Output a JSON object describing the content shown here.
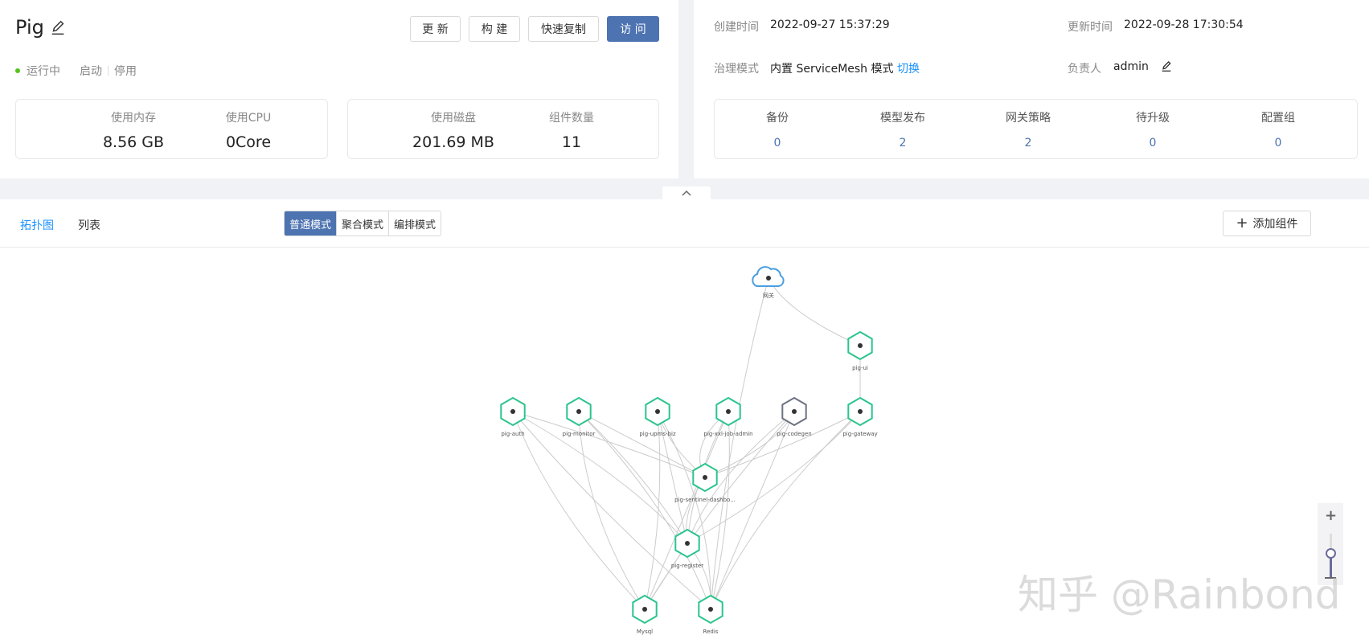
{
  "app": {
    "name": "Pig",
    "status": "运行中",
    "actions": [
      "启动",
      "停用"
    ]
  },
  "toolbar": {
    "update_label": "更 新",
    "build_label": "构 建",
    "copy_label": "快速复制",
    "visit_label": "访 问"
  },
  "stats": {
    "memory_label": "使用内存",
    "memory_value": "8.56 GB",
    "cpu_label": "使用CPU",
    "cpu_value": "0Core",
    "disk_label": "使用磁盘",
    "disk_value": "201.69 MB",
    "components_label": "组件数量",
    "components_value": "11"
  },
  "info": {
    "created_label": "创建时间",
    "created_value": "2022-09-27 15:37:29",
    "updated_label": "更新时间",
    "updated_value": "2022-09-28 17:30:54",
    "governance_label": "治理模式",
    "governance_value": "内置 ServiceMesh 模式",
    "governance_switch": "切换",
    "owner_label": "负责人",
    "owner_value": "admin"
  },
  "counts": [
    {
      "label": "备份",
      "value": "0"
    },
    {
      "label": "模型发布",
      "value": "2"
    },
    {
      "label": "网关策略",
      "value": "2"
    },
    {
      "label": "待升级",
      "value": "0"
    },
    {
      "label": "配置组",
      "value": "0"
    }
  ],
  "view": {
    "tabs": [
      "拓扑图",
      "列表"
    ],
    "active_tab": "拓扑图",
    "modes": [
      "普通模式",
      "聚合模式",
      "编排模式"
    ],
    "active_mode": "普通模式",
    "add_component_label": "添加组件"
  },
  "topology": {
    "nodes": [
      {
        "id": "gateway-cloud",
        "label": "网关",
        "kind": "cloud"
      },
      {
        "id": "pig-ui",
        "label": "pig-ui",
        "kind": "running"
      },
      {
        "id": "pig-auth",
        "label": "pig-auth",
        "kind": "running"
      },
      {
        "id": "pig-monitor",
        "label": "pig-monitor",
        "kind": "running"
      },
      {
        "id": "pig-upms-biz",
        "label": "pig-upms-biz",
        "kind": "running"
      },
      {
        "id": "pig-xxl-job-admin",
        "label": "pig-xxl-job-admin",
        "kind": "running"
      },
      {
        "id": "pig-codegen",
        "label": "pig-codegen",
        "kind": "stopped"
      },
      {
        "id": "pig-gateway",
        "label": "pig-gateway",
        "kind": "running"
      },
      {
        "id": "pig-sentinel",
        "label": "pig-sentinel-dashbo...",
        "kind": "running"
      },
      {
        "id": "pig-register",
        "label": "pig-register",
        "kind": "running"
      },
      {
        "id": "mysql",
        "label": "Mysql",
        "kind": "running"
      },
      {
        "id": "redis",
        "label": "Redis",
        "kind": "running"
      }
    ],
    "edges": [
      [
        "gateway-cloud",
        "pig-ui"
      ],
      [
        "gateway-cloud",
        "redis"
      ],
      [
        "pig-ui",
        "pig-gateway"
      ],
      [
        "pig-auth",
        "pig-sentinel"
      ],
      [
        "pig-auth",
        "pig-register"
      ],
      [
        "pig-auth",
        "mysql"
      ],
      [
        "pig-auth",
        "redis"
      ],
      [
        "pig-monitor",
        "pig-sentinel"
      ],
      [
        "pig-monitor",
        "pig-register"
      ],
      [
        "pig-monitor",
        "redis"
      ],
      [
        "pig-monitor",
        "mysql"
      ],
      [
        "pig-upms-biz",
        "pig-sentinel"
      ],
      [
        "pig-upms-biz",
        "pig-register"
      ],
      [
        "pig-upms-biz",
        "mysql"
      ],
      [
        "pig-upms-biz",
        "redis"
      ],
      [
        "pig-xxl-job-admin",
        "pig-sentinel"
      ],
      [
        "pig-xxl-job-admin",
        "pig-register"
      ],
      [
        "pig-xxl-job-admin",
        "mysql"
      ],
      [
        "pig-xxl-job-admin",
        "redis"
      ],
      [
        "pig-codegen",
        "pig-sentinel"
      ],
      [
        "pig-codegen",
        "pig-register"
      ],
      [
        "pig-codegen",
        "mysql"
      ],
      [
        "pig-codegen",
        "redis"
      ],
      [
        "pig-gateway",
        "pig-sentinel"
      ],
      [
        "pig-gateway",
        "pig-register"
      ],
      [
        "pig-gateway",
        "redis"
      ],
      [
        "pig-sentinel",
        "pig-register"
      ],
      [
        "pig-register",
        "mysql"
      ],
      [
        "pig-register",
        "redis"
      ]
    ]
  },
  "colors": {
    "primary": "#4d73b1",
    "running": "#2bc48d",
    "stopped": "#6b7280",
    "edge": "#cccccc"
  },
  "watermark": "知乎 @Rainbond"
}
